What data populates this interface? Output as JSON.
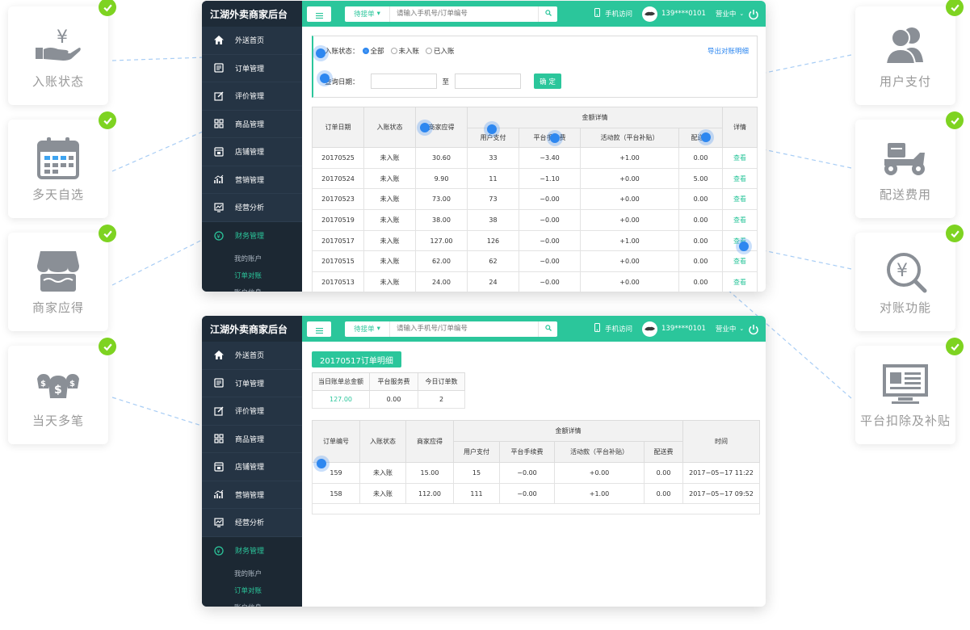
{
  "colors": {
    "accent": "#2bc69b",
    "sidebar": "#253444",
    "check": "#7ed321",
    "link": "#2d87f0"
  },
  "left_cards": [
    {
      "label": "入账状态",
      "icon": "yen-hand-icon"
    },
    {
      "label": "多天自选",
      "icon": "calendar-icon"
    },
    {
      "label": "商家应得",
      "icon": "storefront-icon"
    },
    {
      "label": "当天多笔",
      "icon": "money-bags-icon"
    }
  ],
  "right_cards": [
    {
      "label": "用户支付",
      "icon": "users-icon"
    },
    {
      "label": "配送费用",
      "icon": "scooter-icon"
    },
    {
      "label": "对账功能",
      "icon": "yen-search-icon"
    },
    {
      "label": "平台扣除及补贴",
      "icon": "monitor-icon"
    }
  ],
  "app": {
    "brand": "江湖外卖商家后台",
    "search": {
      "filter": "待接单",
      "placeholder": "请输入手机号/订单编号"
    },
    "mobile_access": "手机访问",
    "user_phone": "139****0101",
    "status": "营业中",
    "nav": [
      {
        "label": "外送首页",
        "icon": "home-icon"
      },
      {
        "label": "订单管理",
        "icon": "order-list-icon"
      },
      {
        "label": "评价管理",
        "icon": "edit-icon"
      },
      {
        "label": "商品管理",
        "icon": "grid-icon"
      },
      {
        "label": "店铺管理",
        "icon": "shop-icon"
      },
      {
        "label": "营销管理",
        "icon": "trend-icon"
      },
      {
        "label": "经营分析",
        "icon": "chart-monitor-icon"
      },
      {
        "label": "财务管理",
        "icon": "finance-icon"
      }
    ],
    "subnav": [
      "我的账户",
      "订单对账",
      "账户信息"
    ]
  },
  "screen1": {
    "filter": {
      "status_label": "入账状态：",
      "options": [
        "全部",
        "未入账",
        "已入账"
      ],
      "export": "导出对账明细",
      "date_label": "查询日期：",
      "to": "至",
      "confirm": "确 定"
    },
    "headers": {
      "date": "订单日期",
      "status": "入账状态",
      "merchant": "商家应得",
      "details": "金额详情",
      "user_pay": "用户支付",
      "fee": "平台手续费",
      "activity": "活动款（平台补贴）",
      "delivery": "配送费",
      "view": "详情"
    },
    "rows": [
      [
        "20170525",
        "未入账",
        "30.60",
        "33",
        "−3.40",
        "+1.00",
        "0.00",
        "查看"
      ],
      [
        "20170524",
        "未入账",
        "9.90",
        "11",
        "−1.10",
        "+0.00",
        "5.00",
        "查看"
      ],
      [
        "20170523",
        "未入账",
        "73.00",
        "73",
        "−0.00",
        "+0.00",
        "0.00",
        "查看"
      ],
      [
        "20170519",
        "未入账",
        "38.00",
        "38",
        "−0.00",
        "+0.00",
        "0.00",
        "查看"
      ],
      [
        "20170517",
        "未入账",
        "127.00",
        "126",
        "−0.00",
        "+1.00",
        "0.00",
        "查看"
      ],
      [
        "20170515",
        "未入账",
        "62.00",
        "62",
        "−0.00",
        "+0.00",
        "0.00",
        "查看"
      ],
      [
        "20170513",
        "未入账",
        "24.00",
        "24",
        "−0.00",
        "+0.00",
        "0.00",
        "查看"
      ]
    ]
  },
  "screen2": {
    "title": "20170517订单明细",
    "summary": {
      "headers": [
        "当日账单总金额",
        "平台服务费",
        "今日订单数"
      ],
      "values": [
        "127.00",
        "0.00",
        "2"
      ]
    },
    "headers": {
      "order_no": "订单编号",
      "status": "入账状态",
      "merchant": "商家应得",
      "details": "金额详情",
      "user_pay": "用户支付",
      "fee": "平台手续费",
      "activity": "活动款（平台补贴）",
      "delivery": "配送费",
      "time": "时间"
    },
    "rows": [
      [
        "159",
        "未入账",
        "15.00",
        "15",
        "−0.00",
        "+0.00",
        "0.00",
        "2017−05−17 11:22"
      ],
      [
        "158",
        "未入账",
        "112.00",
        "111",
        "−0.00",
        "+1.00",
        "0.00",
        "2017−05−17 09:52"
      ]
    ]
  }
}
